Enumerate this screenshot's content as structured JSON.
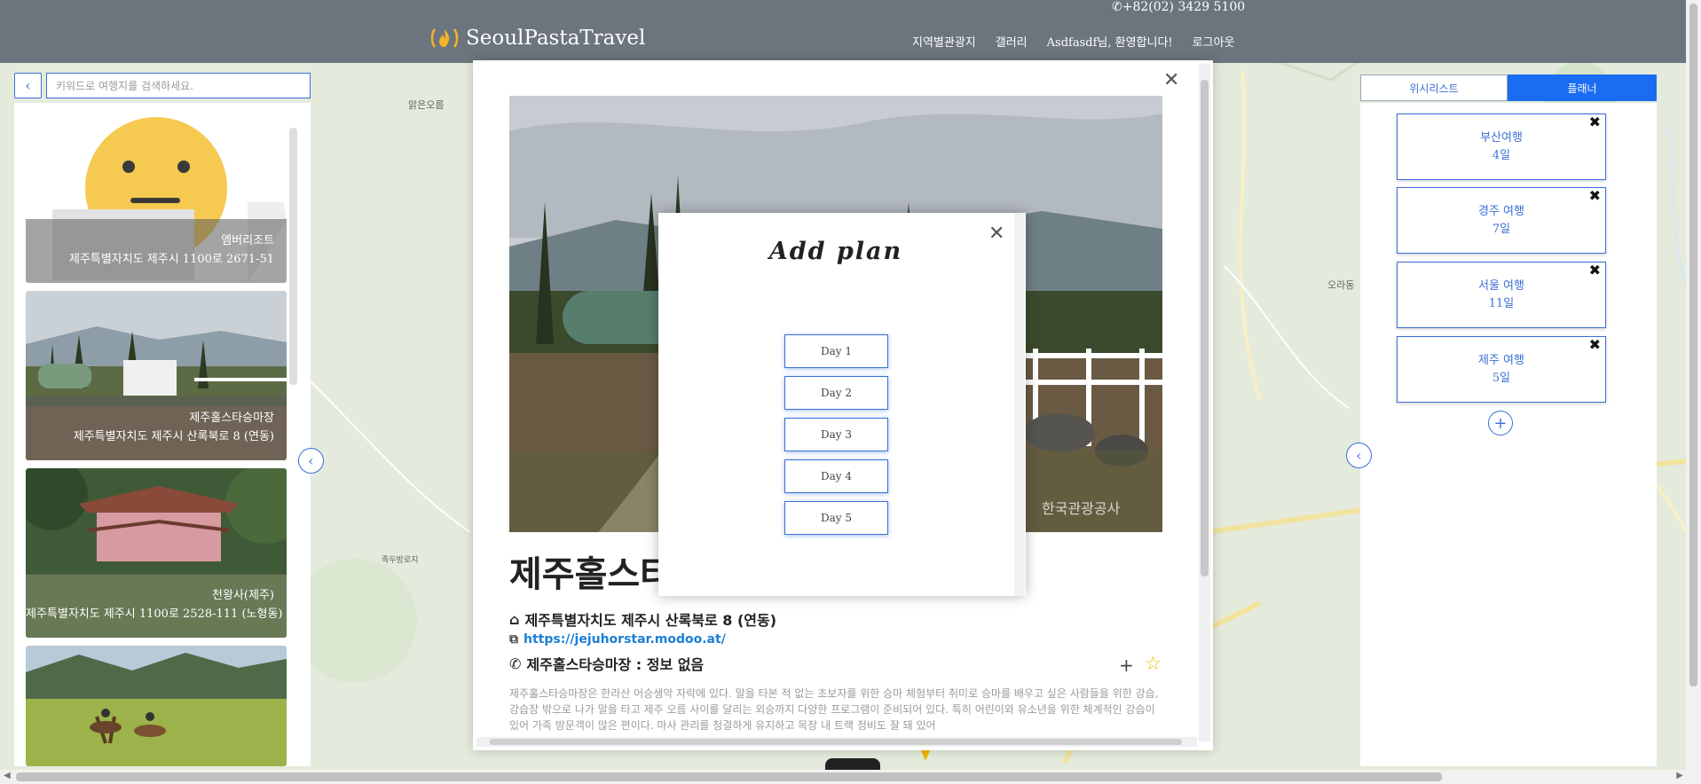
{
  "header": {
    "phone": "+82(02) 3429 5100",
    "brand": "SeoulPastaTravel",
    "nav": [
      "지역별관광지",
      "갤러리",
      "Asdfasdf님, 환영합니다!",
      "로그아웃"
    ]
  },
  "search": {
    "placeholder": "키워드로 여행지를 검색하세요."
  },
  "places": [
    {
      "name": "엠버리조트",
      "address": "제주특별자치도 제주시 1100로 2671-51"
    },
    {
      "name": "제주홀스타승마장",
      "address": "제주특별자치도 제주시 산록북로 8 (연동)"
    },
    {
      "name": "천왕사(제주)",
      "address": "제주특별자치도 제주시 1100로 2528-111 (노형동)"
    },
    {
      "name": "",
      "address": ""
    }
  ],
  "planner": {
    "tabs": [
      "위시리스트",
      "플래너"
    ],
    "plans": [
      {
        "title": "부산여행",
        "days": "4일"
      },
      {
        "title": "경주 여행",
        "days": "7일"
      },
      {
        "title": "서울 여행",
        "days": "11일"
      },
      {
        "title": "제주 여행",
        "days": "5일"
      }
    ]
  },
  "detail": {
    "title": "제주홀스타승마장",
    "address": "제주특별자치도 제주시 산록북로 8 (연동)",
    "link": "https://jejuhorstar.modoo.at/",
    "phone": "제주홀스타승마장 : 정보 없음",
    "description": "제주홀스타승마장은 한라산 어승생악 자락에 있다. 말을 타본 적 없는 초보자를 위한 승마 체험부터 취미로 승마를 배우고 싶은 사람들을 위한 강습, 강습장 밖으로 나가 말을 타고 제주 오름 사이를 달리는 외승까지 다양한 프로그램이 준비되어 있다. 특히 어린이와 유소년을 위한 체계적인 강습이 있어 가족 방문객이 많은 편이다. 마사 관리를 청결하게 유지하고 목장 내 트랙 정비도 잘 돼 있어",
    "watermark": "한국관광공사"
  },
  "add_plan": {
    "title": "Add plan",
    "days": [
      "Day 1",
      "Day 2",
      "Day 3",
      "Day 4",
      "Day 5"
    ]
  },
  "map_labels": [
    "맑은오름",
    "오라동",
    "족두방로지"
  ],
  "colors": {
    "navbar": "#6c757d",
    "accent": "#3b6fd6",
    "planner_tab": "#1a6cf2",
    "star": "#e7c200",
    "link": "#1a7fd6"
  },
  "icons": [
    "fire-logo-icon",
    "phone-icon",
    "chevron-left-icon",
    "close-icon",
    "home-icon",
    "external-link-icon",
    "plus-icon",
    "star-icon"
  ]
}
